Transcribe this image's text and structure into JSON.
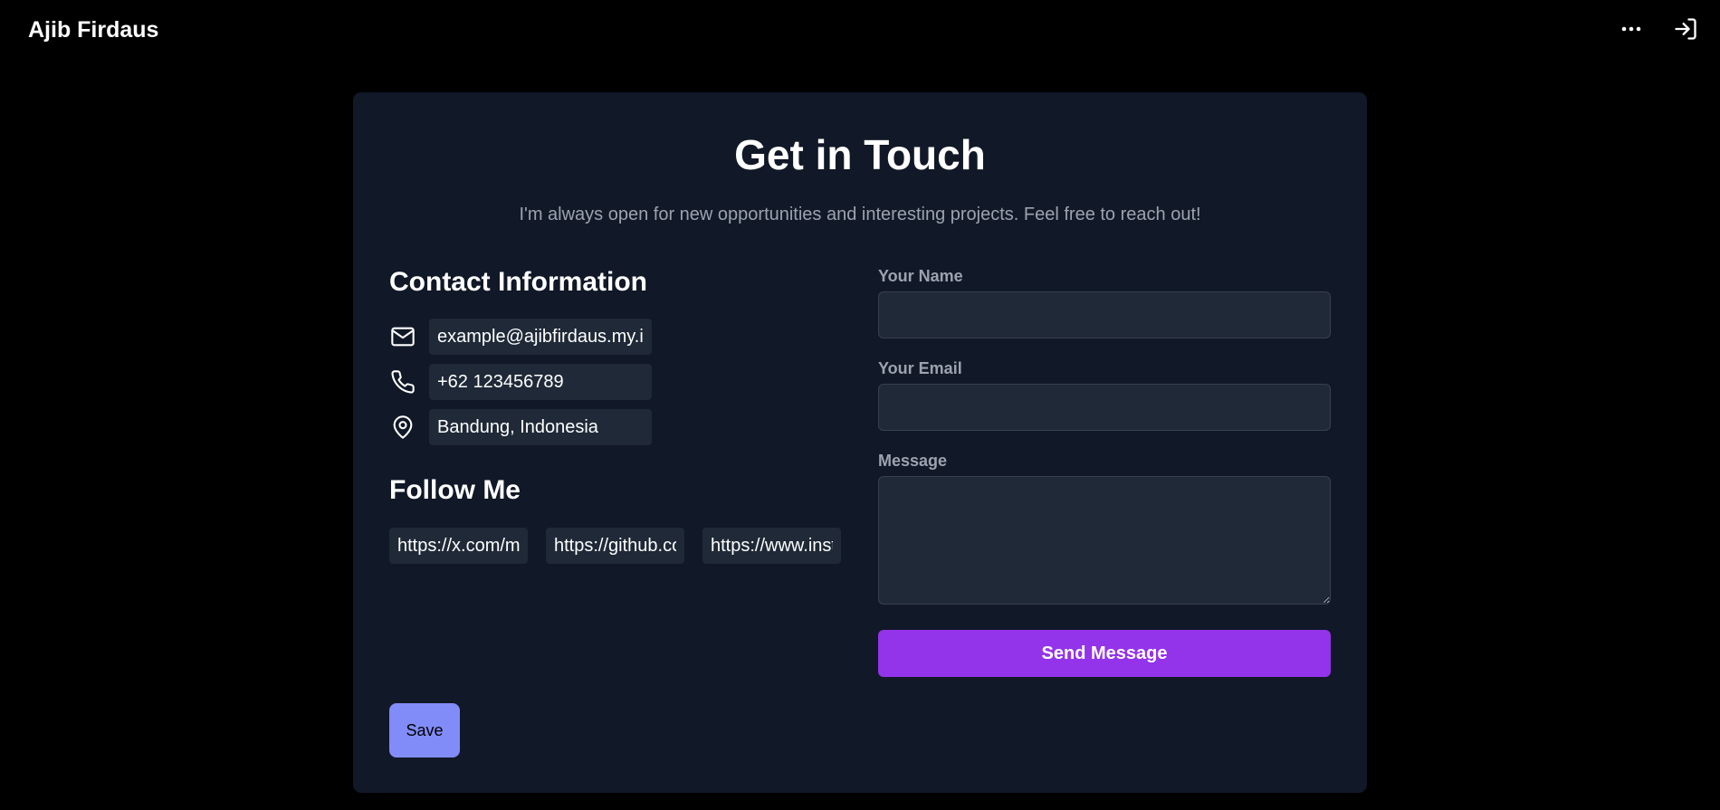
{
  "header": {
    "brand": "Ajib Firdaus",
    "icons": [
      "more-icon",
      "login-icon"
    ]
  },
  "contact_section": {
    "title": "Get in Touch",
    "subtitle": "I'm always open for new opportunities and interesting projects. Feel free to reach out!",
    "contact_info": {
      "heading": "Contact Information",
      "email": "example@ajibfirdaus.my.id",
      "phone": "+62 123456789",
      "location": "Bandung, Indonesia"
    },
    "follow": {
      "heading": "Follow Me",
      "links": [
        "https://x.com/m",
        "https://github.com",
        "https://www.instagram.com"
      ]
    },
    "form": {
      "name_label": "Your Name",
      "name_value": "",
      "email_label": "Your Email",
      "email_value": "",
      "message_label": "Message",
      "message_value": "",
      "submit_label": "Send Message"
    },
    "save_label": "Save"
  },
  "colors": {
    "background": "#000000",
    "card": "#111827",
    "input": "#1f2937",
    "muted_text": "#9ca3af",
    "primary_button": "#9333ea",
    "save_button": "#818cf8"
  }
}
